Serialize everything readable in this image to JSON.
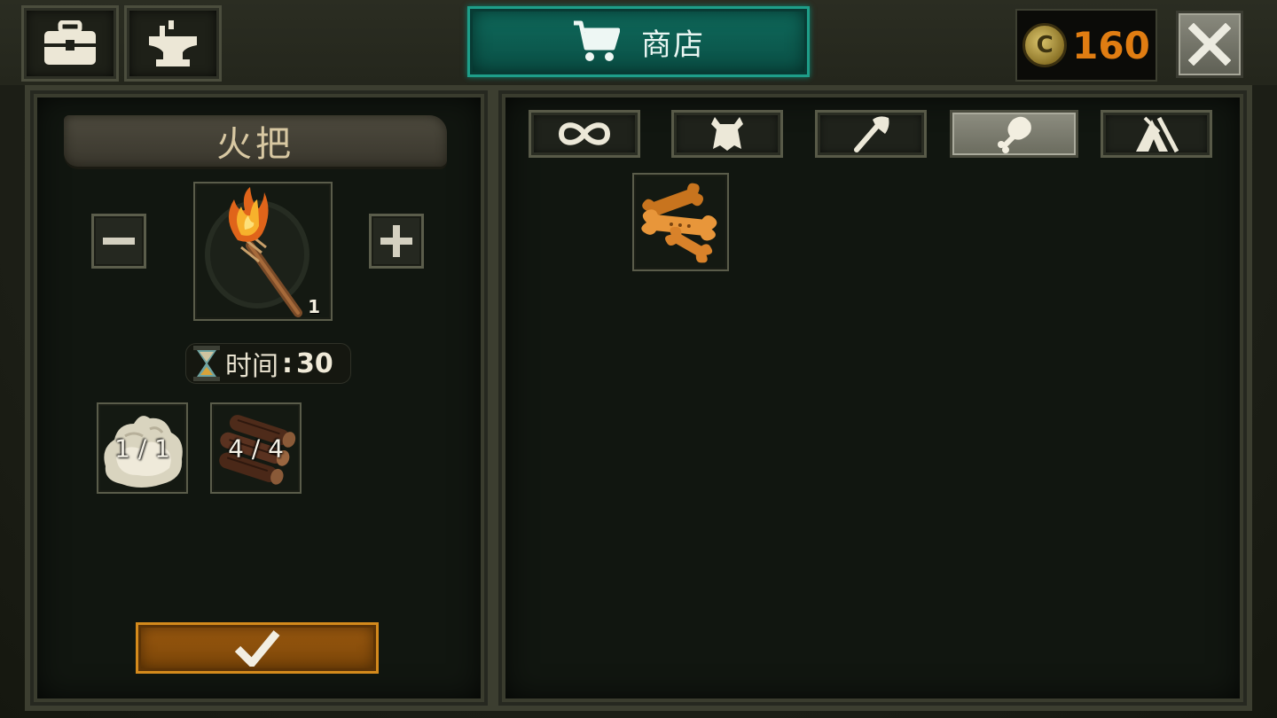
{
  "header": {
    "shop_label": "商店",
    "coins": "160",
    "coin_symbol": "C"
  },
  "craft": {
    "item_name": "火把",
    "item_count": "1",
    "time_label": "时间",
    "time_separator": ":",
    "time_value": "30",
    "materials": [
      {
        "name": "cotton",
        "icon": "cotton-icon",
        "count": "1 / 1"
      },
      {
        "name": "logs",
        "icon": "logs-icon",
        "count": "4 / 4"
      }
    ]
  },
  "tabs": [
    {
      "icon": "infinity-icon",
      "active": false
    },
    {
      "icon": "hide-icon",
      "active": false
    },
    {
      "icon": "axe-icon",
      "active": false
    },
    {
      "icon": "food-icon",
      "active": true
    },
    {
      "icon": "camp-icon",
      "active": false
    }
  ],
  "items": [
    {
      "icon": "bone-biscuit-icon"
    }
  ],
  "colors": {
    "shop_accent": "#0f6a5c",
    "coin_text": "#e07d12",
    "confirm": "#9c5a10"
  }
}
